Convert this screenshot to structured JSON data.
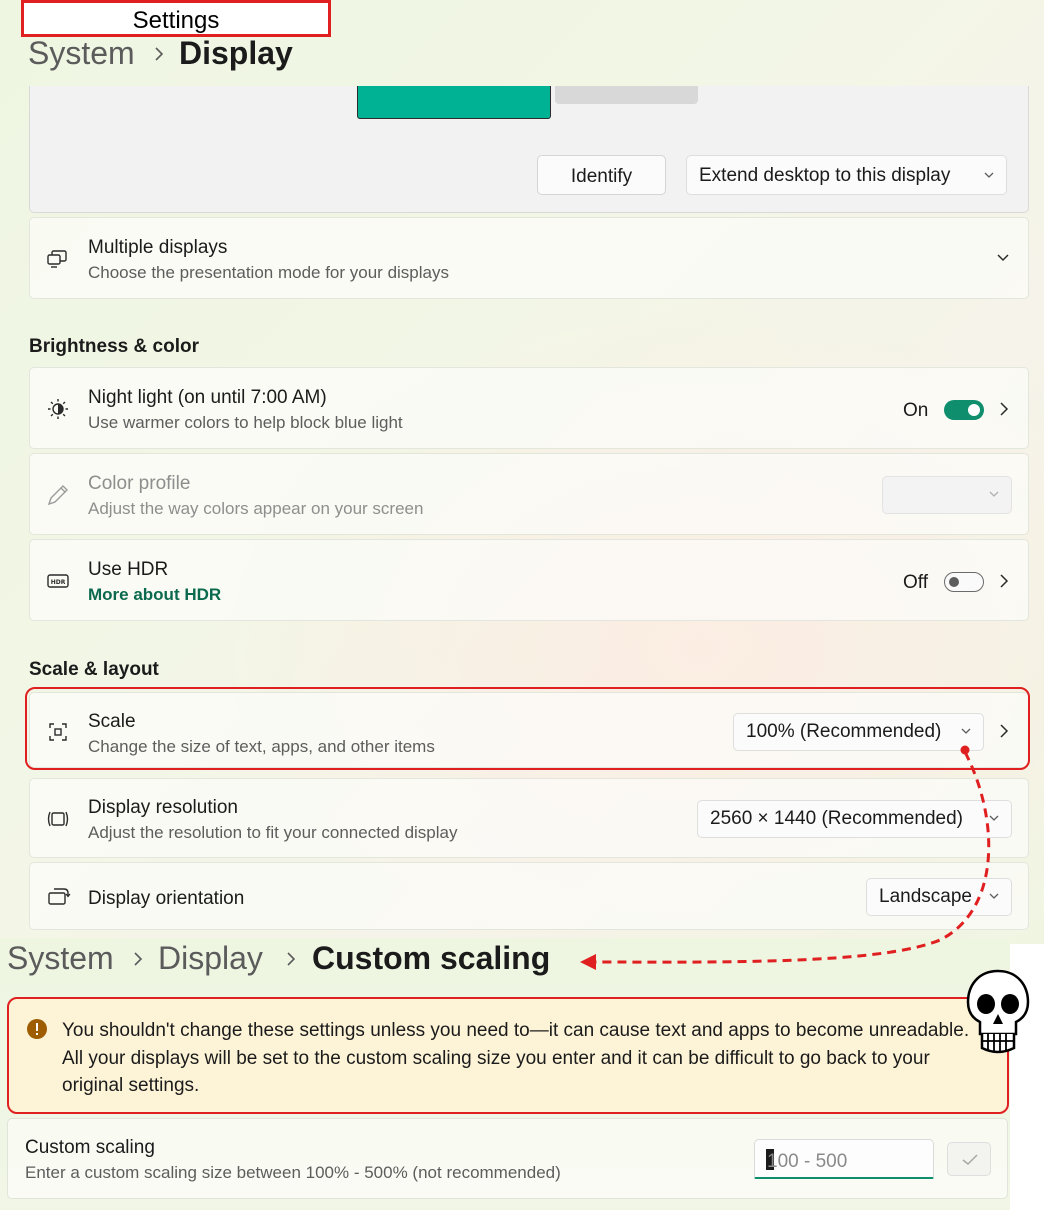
{
  "window": {
    "title": "Settings"
  },
  "breadcrumb_top": {
    "items": [
      "System",
      "Display"
    ]
  },
  "display_preview": {
    "identify_label": "Identify",
    "extend_select": "Extend desktop to this display"
  },
  "multiple_displays": {
    "title": "Multiple displays",
    "subtitle": "Choose the presentation mode for your displays"
  },
  "brightness_section": {
    "heading": "Brightness & color"
  },
  "night_light": {
    "title": "Night light (on until 7:00 AM)",
    "subtitle": "Use warmer colors to help block blue light",
    "state_label": "On",
    "state": true
  },
  "color_profile": {
    "title": "Color profile",
    "subtitle": "Adjust the way colors appear on your screen",
    "selected": ""
  },
  "hdr": {
    "title": "Use HDR",
    "link": "More about HDR",
    "state_label": "Off",
    "state": false
  },
  "scale_section": {
    "heading": "Scale & layout"
  },
  "scale": {
    "title": "Scale",
    "subtitle": "Change the size of text, apps, and other items",
    "selected": "100% (Recommended)"
  },
  "resolution": {
    "title": "Display resolution",
    "subtitle": "Adjust the resolution to fit your connected display",
    "selected": "2560 × 1440 (Recommended)"
  },
  "orientation": {
    "title": "Display orientation",
    "selected": "Landscape"
  },
  "breadcrumb_custom": {
    "items": [
      "System",
      "Display",
      "Custom scaling"
    ]
  },
  "warning": {
    "text": "You shouldn't change these settings unless you need to—it can cause text and apps to become unreadable. All your displays will be set to the custom scaling size you enter and it can be difficult to go back to your original settings."
  },
  "custom_scaling": {
    "title": "Custom scaling",
    "subtitle": "Enter a custom scaling size between 100% - 500% (not recommended)",
    "input_value": "",
    "input_placeholder": "100 - 500"
  },
  "colors": {
    "accent": "#0e8e6d",
    "monitor_selected": "#00b294",
    "annotation_red": "#e02020",
    "warning_bg": "#fdf4d8",
    "warning_icon": "#9d5d00",
    "link": "#0b6a4e"
  },
  "icons": [
    "display-pair-icon",
    "brightness-icon",
    "eyedropper-icon",
    "hdr-icon",
    "scale-icon",
    "resolution-icon",
    "orientation-icon",
    "warning-icon",
    "checkmark-icon",
    "skull-icon",
    "chevron-right-icon",
    "chevron-down-icon"
  ]
}
